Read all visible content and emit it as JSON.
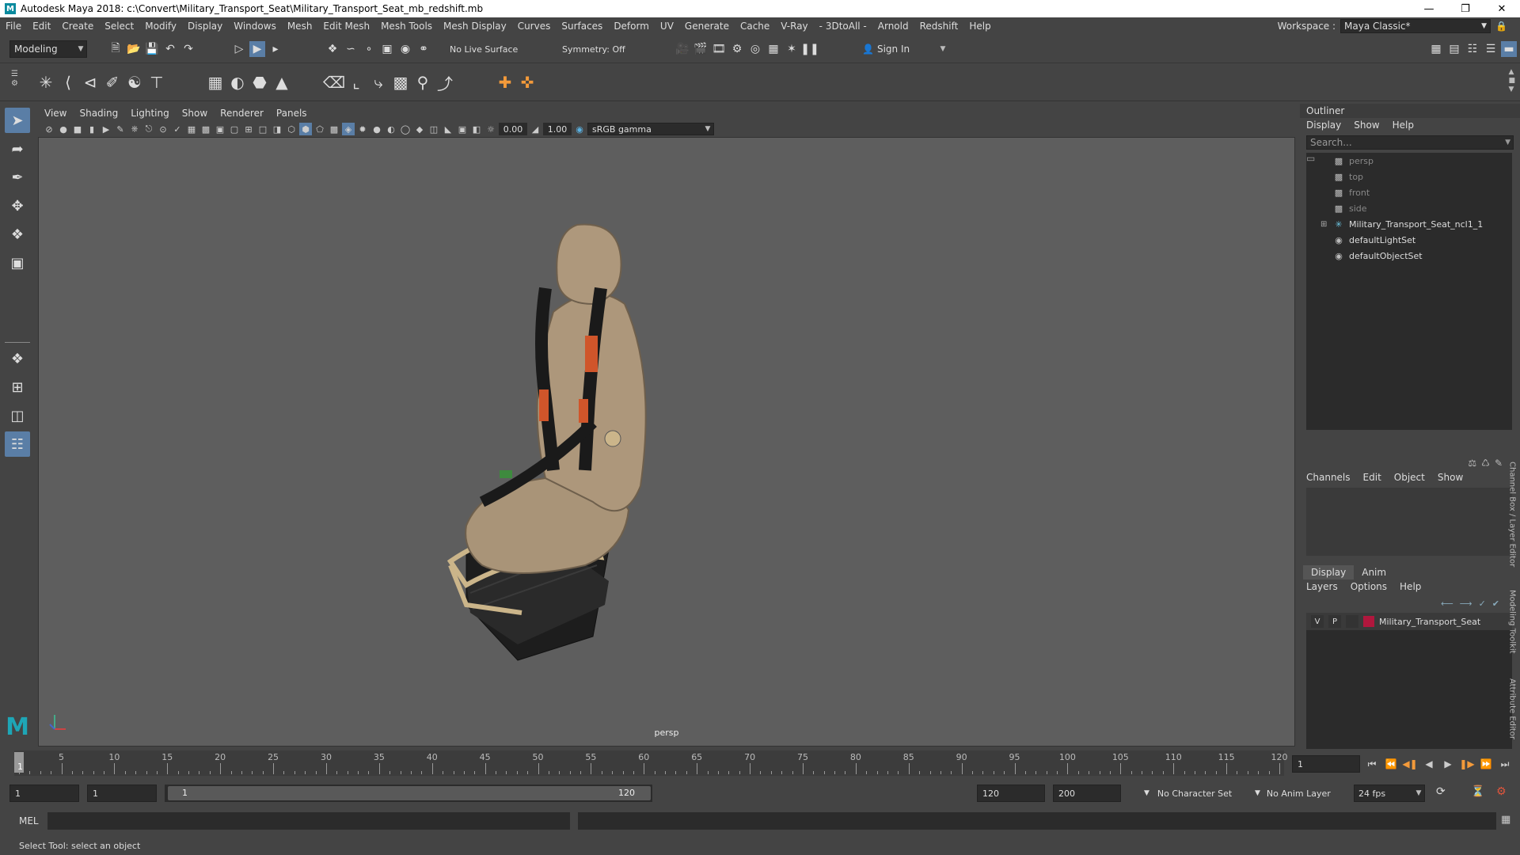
{
  "window": {
    "title": "Autodesk Maya 2018: c:\\Convert\\Military_Transport_Seat\\Military_Transport_Seat_mb_redshift.mb",
    "logo": "M"
  },
  "menubar": [
    "File",
    "Edit",
    "Create",
    "Select",
    "Modify",
    "Display",
    "Windows",
    "Mesh",
    "Edit Mesh",
    "Mesh Tools",
    "Mesh Display",
    "Curves",
    "Surfaces",
    "Deform",
    "UV",
    "Generate",
    "Cache",
    "V-Ray",
    "- 3DtoAll -",
    "Arnold",
    "Redshift",
    "Help"
  ],
  "workspace": {
    "label": "Workspace :",
    "value": "Maya Classic*"
  },
  "statusline": {
    "mode": "Modeling",
    "live_surface": "No Live Surface",
    "symmetry": "Symmetry: Off",
    "sign_in": "Sign In"
  },
  "viewport": {
    "menu": [
      "View",
      "Shading",
      "Lighting",
      "Show",
      "Renderer",
      "Panels"
    ],
    "exposure": "0.00",
    "gamma": "1.00",
    "color_space": "sRGB gamma",
    "camera_label": "persp"
  },
  "outliner": {
    "title": "Outliner",
    "menu": [
      "Display",
      "Show",
      "Help"
    ],
    "search_placeholder": "Search...",
    "items": [
      {
        "label": "persp",
        "type": "camera"
      },
      {
        "label": "top",
        "type": "camera"
      },
      {
        "label": "front",
        "type": "camera"
      },
      {
        "label": "side",
        "type": "camera"
      },
      {
        "label": "Military_Transport_Seat_ncl1_1",
        "type": "group"
      },
      {
        "label": "defaultLightSet",
        "type": "set"
      },
      {
        "label": "defaultObjectSet",
        "type": "set"
      }
    ]
  },
  "channelbox": {
    "menu": [
      "Channels",
      "Edit",
      "Object",
      "Show"
    ]
  },
  "layereditor": {
    "tabs": [
      "Display",
      "Anim"
    ],
    "menu": [
      "Layers",
      "Options",
      "Help"
    ],
    "layer": {
      "v": "V",
      "p": "P",
      "name": "Military_Transport_Seat",
      "color": "#b0173d"
    }
  },
  "side_tabs": [
    "Channel Box / Layer Editor",
    "Modeling Toolkit",
    "Attribute Editor"
  ],
  "timeslider": {
    "ticks": [
      1,
      5,
      10,
      15,
      20,
      25,
      30,
      35,
      40,
      45,
      50,
      55,
      60,
      65,
      70,
      75,
      80,
      85,
      90,
      95,
      100,
      105,
      110,
      115,
      120
    ],
    "labels": [
      "5",
      "10",
      "15",
      "20",
      "25",
      "30",
      "35",
      "40",
      "45",
      "50",
      "55",
      "60",
      "65",
      "70",
      "75",
      "80",
      "85",
      "90",
      "95",
      "100",
      "105",
      "110",
      "115",
      "120"
    ],
    "current_frame": "1",
    "current_frame_field": "1"
  },
  "rangeslider": {
    "start": "1",
    "playback_start": "1",
    "range_left": "1",
    "range_right": "120",
    "playback_end": "120",
    "end": "200",
    "character_set": "No Character Set",
    "anim_layer": "No Anim Layer",
    "fps": "24 fps"
  },
  "cmdline": {
    "label": "MEL"
  },
  "helpline": {
    "text": "Select Tool: select an object"
  }
}
